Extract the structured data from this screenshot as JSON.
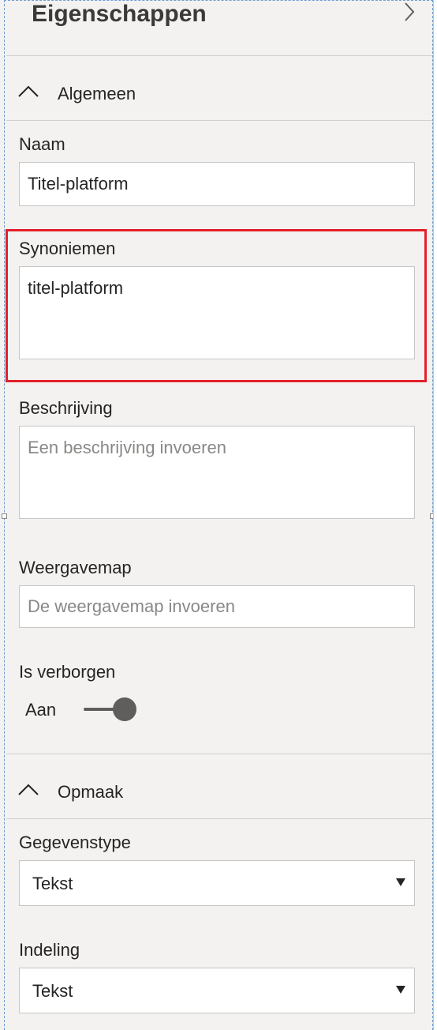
{
  "pane": {
    "title": "Eigenschappen",
    "collapse_icon": "chevron-right-icon"
  },
  "sections": {
    "general": {
      "label": "Algemeen",
      "icon": "chevron-up-icon",
      "expanded": true
    },
    "format": {
      "label": "Opmaak",
      "icon": "chevron-up-icon",
      "expanded": true
    }
  },
  "fields": {
    "name": {
      "label": "Naam",
      "value": "Titel-platform"
    },
    "synonyms": {
      "label": "Synoniemen",
      "value": "titel-platform"
    },
    "description": {
      "label": "Beschrijving",
      "value": "",
      "placeholder": "Een beschrijving invoeren"
    },
    "display_folder": {
      "label": "Weergavemap",
      "value": "",
      "placeholder": "De weergavemap invoeren"
    },
    "is_hidden": {
      "label": "Is verborgen",
      "state_label": "Aan",
      "on": true
    },
    "data_type": {
      "label": "Gegevenstype",
      "value": "Tekst",
      "caret_icon": "triangle-down-icon"
    },
    "format": {
      "label": "Indeling",
      "value": "Tekst",
      "caret_icon": "triangle-down-icon"
    }
  },
  "colors": {
    "highlight": "#e3202a",
    "toggle": "#605e5c",
    "pane_background": "#f3f2f1"
  }
}
